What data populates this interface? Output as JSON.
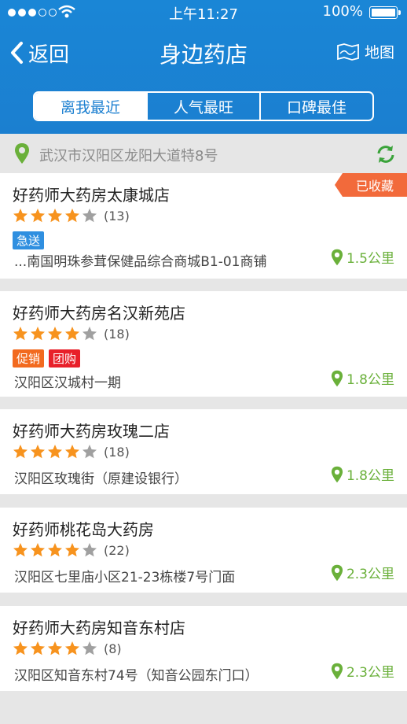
{
  "status_bar": {
    "time": "上午11:27",
    "battery": "100%"
  },
  "nav": {
    "back_label": "返回",
    "title": "身边药店",
    "map_label": "地图"
  },
  "tabs": [
    {
      "label": "离我最近",
      "selected": true
    },
    {
      "label": "人气最旺",
      "selected": false
    },
    {
      "label": "口碑最佳",
      "selected": false
    }
  ],
  "location": {
    "address": "武汉市汉阳区龙阳大道特8号"
  },
  "colors": {
    "accent": "#1b7fd0",
    "star": "#f7931e",
    "distance": "#6ab03a",
    "favorite": "#f26a3b"
  },
  "stores": [
    {
      "name": "好药师大药房太康城店",
      "rating": 4,
      "reviews": "(13)",
      "tags": [
        {
          "label": "急送",
          "color": "#2f8fe0"
        }
      ],
      "favorite": "已收藏",
      "address": "...南国明珠参茸保健品综合商城B1-01商铺",
      "distance": "1.5公里"
    },
    {
      "name": "好药师大药房名汉新苑店",
      "rating": 4,
      "reviews": "(18)",
      "tags": [
        {
          "label": "促销",
          "color": "#f26a1f"
        },
        {
          "label": "团购",
          "color": "#e8202a"
        }
      ],
      "favorite": "",
      "address": "汉阳区汉城村一期",
      "distance": "1.8公里"
    },
    {
      "name": "好药师大药房玫瑰二店",
      "rating": 4,
      "reviews": "(18)",
      "tags": [],
      "favorite": "",
      "address": "汉阳区玫瑰街（原建设银行）",
      "distance": "1.8公里"
    },
    {
      "name": "好药师桃花岛大药房",
      "rating": 4,
      "reviews": "(22)",
      "tags": [],
      "favorite": "",
      "address": "汉阳区七里庙小区21-23栋楼7号门面",
      "distance": "2.3公里"
    },
    {
      "name": "好药师大药房知音东村店",
      "rating": 4,
      "reviews": "(8)",
      "tags": [],
      "favorite": "",
      "address": "汉阳区知音东村74号（知音公园东门口）",
      "distance": "2.3公里"
    }
  ]
}
